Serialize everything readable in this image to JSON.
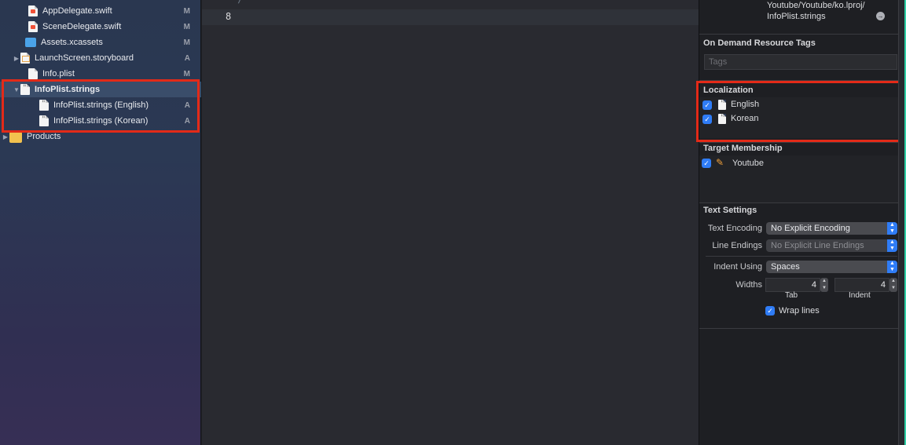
{
  "navigator": {
    "items": [
      {
        "name": "AppDelegate.swift",
        "status": "M"
      },
      {
        "name": "SceneDelegate.swift",
        "status": "M"
      },
      {
        "name": "Assets.xcassets",
        "status": "M"
      },
      {
        "name": "LaunchScreen.storyboard",
        "status": "A"
      },
      {
        "name": "Info.plist",
        "status": "M"
      },
      {
        "name": "InfoPlist.strings",
        "status": ""
      },
      {
        "name": "InfoPlist.strings (English)",
        "status": "A"
      },
      {
        "name": "InfoPlist.strings (Korean)",
        "status": "A"
      },
      {
        "name": "Products",
        "status": ""
      }
    ]
  },
  "editor": {
    "comment_fragment": "*/",
    "line_number": "8"
  },
  "inspector": {
    "path_line1": "Youtube/Youtube/ko.lproj/",
    "path_line2": "InfoPlist.strings",
    "on_demand": {
      "header": "On Demand Resource Tags",
      "tags_placeholder": "Tags"
    },
    "localization": {
      "header": "Localization",
      "languages": [
        "English",
        "Korean"
      ]
    },
    "target_membership": {
      "header": "Target Membership",
      "target": "Youtube"
    },
    "text_settings": {
      "header": "Text Settings",
      "encoding_label": "Text Encoding",
      "encoding_value": "No Explicit Encoding",
      "line_endings_label": "Line Endings",
      "line_endings_value": "No Explicit Line Endings",
      "indent_using_label": "Indent Using",
      "indent_using_value": "Spaces",
      "widths_label": "Widths",
      "tab_value": "4",
      "indent_value": "4",
      "tab_label": "Tab",
      "indent_label": "Indent",
      "wrap_lines_label": "Wrap lines"
    }
  },
  "colors": {
    "highlight": "#e32a18",
    "accent": "#2f7cf6"
  }
}
